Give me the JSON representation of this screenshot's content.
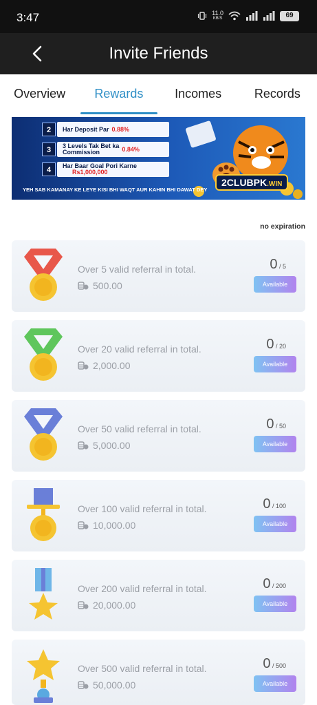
{
  "status_bar": {
    "time": "3:47",
    "net_speed_value": "11.0",
    "net_speed_unit": "KB/S",
    "battery": "69"
  },
  "header": {
    "title": "Invite Friends"
  },
  "tabs": [
    {
      "label": "Overview",
      "active": false
    },
    {
      "label": "Rewards",
      "active": true
    },
    {
      "label": "Incomes",
      "active": false
    },
    {
      "label": "Records",
      "active": false
    }
  ],
  "banner": {
    "rows": [
      {
        "num": "2",
        "text": "Har Deposit Par",
        "accent": "0.88%"
      },
      {
        "num": "3",
        "text_line1": "3 Levels Tak Bet ka",
        "text_line2": "Commission",
        "accent": "0.84%"
      },
      {
        "num": "4",
        "text_line1": "Har Baar Goal Pori Karne",
        "accent": "Rs1,000,000"
      }
    ],
    "footer": "YEH SAB KAMANAY KE LEYE KISI BHI WAQT AUR KAHIN BHI DAWAT DEY",
    "logo_main": "2CLUBPK",
    "logo_suffix": ".WIN"
  },
  "expiration_label": "no expiration",
  "rewards": [
    {
      "description": "Over 5 valid referral in total.",
      "amount": "500.00",
      "current": "0",
      "target": "5",
      "button": "Available",
      "medal": "red-ribbon-medal"
    },
    {
      "description": "Over 20 valid referral in total.",
      "amount": "2,000.00",
      "current": "0",
      "target": "20",
      "button": "Available",
      "medal": "green-ribbon-medal"
    },
    {
      "description": "Over 50 valid referral in total.",
      "amount": "5,000.00",
      "current": "0",
      "target": "50",
      "button": "Available",
      "medal": "blue-ribbon-medal"
    },
    {
      "description": "Over 100 valid referral in total.",
      "amount": "10,000.00",
      "current": "0",
      "target": "100",
      "button": "Available",
      "medal": "hat-medal"
    },
    {
      "description": "Over 200 valid referral in total.",
      "amount": "20,000.00",
      "current": "0",
      "target": "200",
      "button": "Available",
      "medal": "star-medal"
    },
    {
      "description": "Over 500 valid referral in total.",
      "amount": "50,000.00",
      "current": "0",
      "target": "500",
      "button": "Available",
      "medal": "gold-star-trophy"
    }
  ],
  "colors": {
    "accent": "#2f8fc6",
    "header_bg": "#1f1f1f",
    "status_bg": "#111111",
    "button_from": "#7fc2f2",
    "button_to": "#b183ee"
  }
}
